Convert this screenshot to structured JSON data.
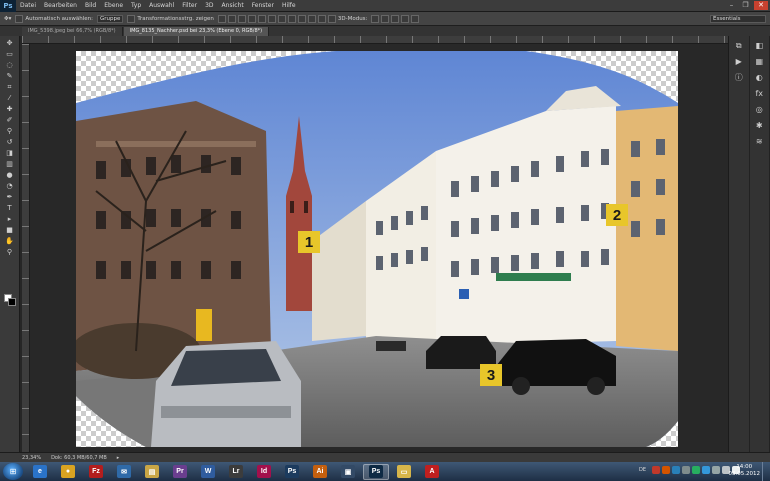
{
  "app": {
    "logo": "Ps"
  },
  "menu": [
    "Datei",
    "Bearbeiten",
    "Bild",
    "Ebene",
    "Typ",
    "Auswahl",
    "Filter",
    "3D",
    "Ansicht",
    "Fenster",
    "Hilfe"
  ],
  "window_controls": {
    "minimize": "–",
    "restore": "❐",
    "close": "✕"
  },
  "options": {
    "auto_select_label": "Automatisch auswählen:",
    "auto_select_value": "Gruppe",
    "transform_label": "Transformationsstrg. zeigen",
    "mode_3d_label": "3D-Modus:",
    "workspace": "Essentials"
  },
  "tabs": [
    {
      "label": "IMG_5398.jpeg bei 66,7% (RGB/8*)"
    },
    {
      "label": "IMG_8135_Nachher.psd bei 23,3% (Ebene 0, RGB/8*)"
    }
  ],
  "callouts": [
    "1",
    "2",
    "3"
  ],
  "status": {
    "zoom": "23,34%",
    "doc": "Dok: 60,3 MB/60,7 MB"
  },
  "taskbar": {
    "apps": [
      {
        "name": "ie",
        "label": "e",
        "color": "#2a73c9"
      },
      {
        "name": "chrome",
        "label": "●",
        "color": "#d9a321"
      },
      {
        "name": "filezilla",
        "label": "Fz",
        "color": "#b31d1d"
      },
      {
        "name": "thunderbird",
        "label": "✉",
        "color": "#2f6aa8"
      },
      {
        "name": "explorer",
        "label": "▤",
        "color": "#c9a646"
      },
      {
        "name": "premiere",
        "label": "Pr",
        "color": "#6a3e8f"
      },
      {
        "name": "word",
        "label": "W",
        "color": "#2f5c9e"
      },
      {
        "name": "lightroom",
        "label": "Lr",
        "color": "#3c3c3c"
      },
      {
        "name": "indesign",
        "label": "Id",
        "color": "#a3104c"
      },
      {
        "name": "photoshop-2",
        "label": "Ps",
        "color": "#1c3b5e"
      },
      {
        "name": "illustrator",
        "label": "Ai",
        "color": "#c45f0e"
      },
      {
        "name": "bridge",
        "label": "▣",
        "color": "#334a66"
      },
      {
        "name": "photoshop",
        "label": "Ps",
        "color": "#0e2a44"
      },
      {
        "name": "folder",
        "label": "▭",
        "color": "#d6b54a"
      },
      {
        "name": "acrobat",
        "label": "A",
        "color": "#c01f1f"
      }
    ],
    "lang": "DE",
    "time": "14:00",
    "date": "03.05.2012"
  }
}
